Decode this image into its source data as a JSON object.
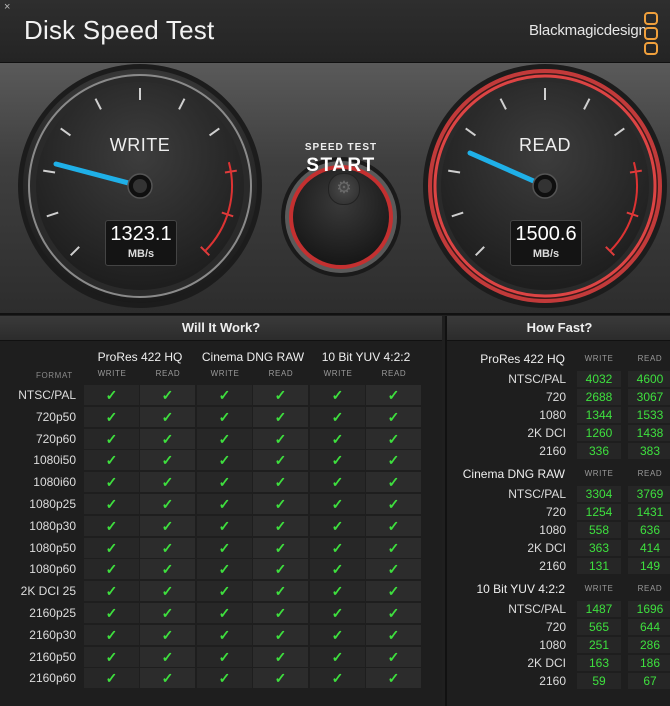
{
  "window": {
    "close_glyph": "×"
  },
  "app_title": "Disk Speed Test",
  "brand": {
    "name": "Blackmagicdesign",
    "logo_icon": "blackmagic-logo-icon",
    "accent": "#f0a03c"
  },
  "gauges": {
    "write": {
      "label": "WRITE",
      "value": "1323.1",
      "unit": "MB/s"
    },
    "read": {
      "label": "READ",
      "value": "1500.6",
      "unit": "MB/s"
    }
  },
  "start_button": {
    "top": "SPEED TEST",
    "main": "START"
  },
  "settings_icon": "gear-icon",
  "will_it_work": {
    "title": "Will It Work?",
    "format_header": "FORMAT",
    "write_header": "WRITE",
    "read_header": "READ",
    "codecs": [
      "ProRes 422 HQ",
      "Cinema DNG RAW",
      "10 Bit YUV 4:2:2"
    ],
    "check": "✓",
    "formats": [
      "NTSC/PAL",
      "720p50",
      "720p60",
      "1080i50",
      "1080i60",
      "1080p25",
      "1080p30",
      "1080p50",
      "1080p60",
      "2K DCI 25",
      "2160p25",
      "2160p30",
      "2160p50",
      "2160p60"
    ]
  },
  "how_fast": {
    "title": "How Fast?",
    "write_header": "WRITE",
    "read_header": "READ",
    "groups": [
      {
        "codec": "ProRes 422 HQ",
        "rows": [
          {
            "label": "NTSC/PAL",
            "write": "4032",
            "read": "4600"
          },
          {
            "label": "720",
            "write": "2688",
            "read": "3067"
          },
          {
            "label": "1080",
            "write": "1344",
            "read": "1533"
          },
          {
            "label": "2K DCI",
            "write": "1260",
            "read": "1438"
          },
          {
            "label": "2160",
            "write": "336",
            "read": "383"
          }
        ]
      },
      {
        "codec": "Cinema DNG RAW",
        "rows": [
          {
            "label": "NTSC/PAL",
            "write": "3304",
            "read": "3769"
          },
          {
            "label": "720",
            "write": "1254",
            "read": "1431"
          },
          {
            "label": "1080",
            "write": "558",
            "read": "636"
          },
          {
            "label": "2K DCI",
            "write": "363",
            "read": "414"
          },
          {
            "label": "2160",
            "write": "131",
            "read": "149"
          }
        ]
      },
      {
        "codec": "10 Bit YUV 4:2:2",
        "rows": [
          {
            "label": "NTSC/PAL",
            "write": "1487",
            "read": "1696"
          },
          {
            "label": "720",
            "write": "565",
            "read": "644"
          },
          {
            "label": "1080",
            "write": "251",
            "read": "286"
          },
          {
            "label": "2K DCI",
            "write": "163",
            "read": "186"
          },
          {
            "label": "2160",
            "write": "59",
            "read": "67"
          }
        ]
      }
    ]
  }
}
